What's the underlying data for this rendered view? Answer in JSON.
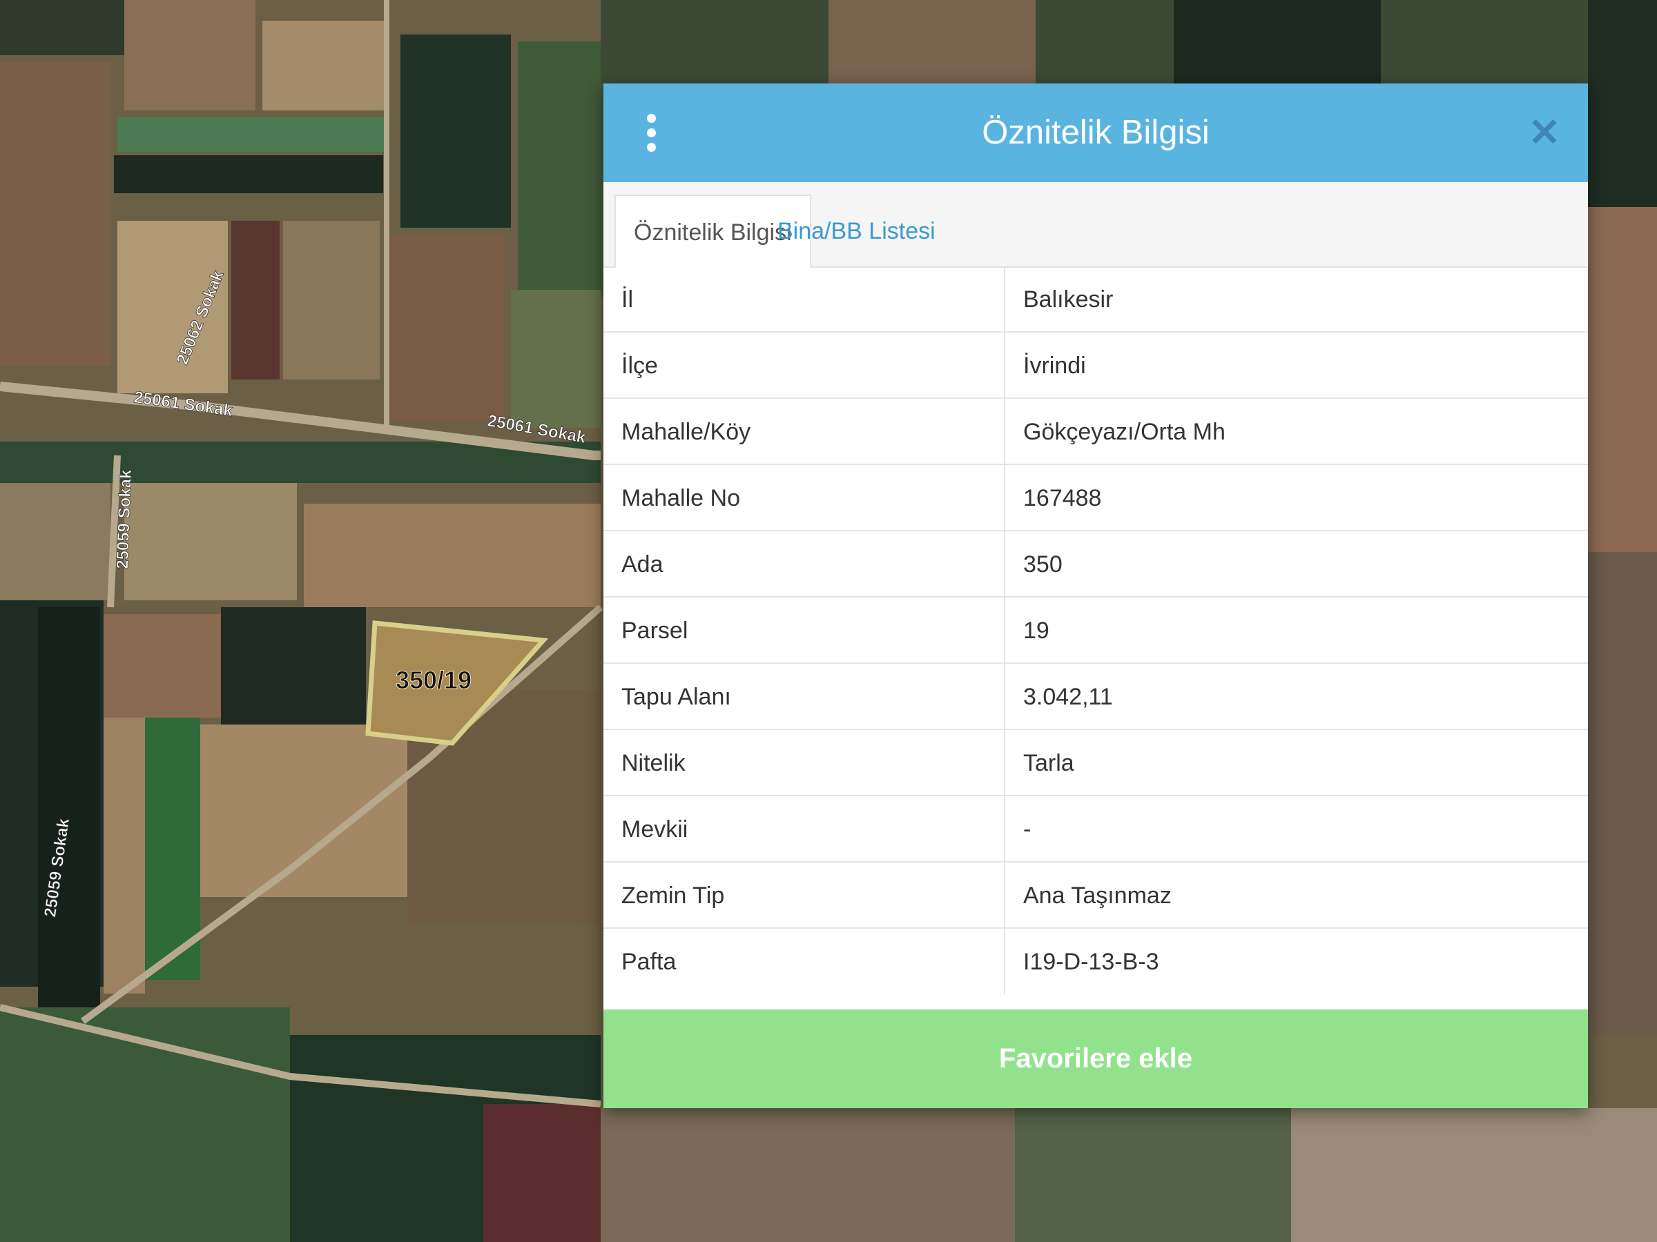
{
  "map": {
    "parcel_label": "350/19",
    "street_labels": [
      "25062 Sokak",
      "25061 Sokak",
      "25061 Sokak",
      "25059 Sokak",
      "25059 Sokak"
    ]
  },
  "panel": {
    "title": "Öznitelik Bilgisi",
    "menu_icon": "vertical-dots-icon",
    "close_icon": "close-icon",
    "tabs": [
      {
        "label": "Öznitelik Bilgisi",
        "active": true
      },
      {
        "label": "Bina/BB Listesi",
        "active": false
      }
    ],
    "rows": [
      {
        "key": "İl",
        "value": "Balıkesir"
      },
      {
        "key": "İlçe",
        "value": "İvrindi"
      },
      {
        "key": "Mahalle/Köy",
        "value": "Gökçeyazı/Orta Mh"
      },
      {
        "key": "Mahalle No",
        "value": "167488"
      },
      {
        "key": "Ada",
        "value": "350"
      },
      {
        "key": "Parsel",
        "value": "19"
      },
      {
        "key": "Tapu Alanı",
        "value": "3.042,11"
      },
      {
        "key": "Nitelik",
        "value": "Tarla"
      },
      {
        "key": "Mevkii",
        "value": "-"
      },
      {
        "key": "Zemin Tip",
        "value": "Ana Taşınmaz"
      },
      {
        "key": "Pafta",
        "value": "I19-D-13-B-3"
      }
    ],
    "favorite_button": "Favorilere ekle"
  },
  "colors": {
    "header": "#5ab4e0",
    "tab_link": "#3a9ad0",
    "favorite_button": "#92e28d",
    "parcel_outline": "#d8cf8a"
  }
}
